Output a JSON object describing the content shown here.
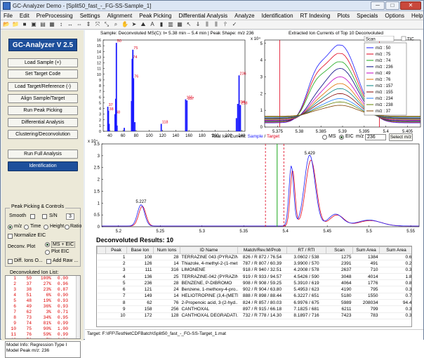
{
  "window": {
    "title": "GC-Analyzer Demo - [Split50_fast_-_FG-SS-Sample_1]",
    "min": "─",
    "max": "□",
    "close": "✕"
  },
  "menu": [
    "File",
    "Edit",
    "PreProcessing",
    "Settings",
    "Alignment",
    "Peak Picking",
    "Differential Analysis",
    "Analyze",
    "Identification",
    "RT Indexing",
    "Plots",
    "Specials",
    "Options",
    "Help"
  ],
  "sidebar": {
    "logo": "GC-Analyzer V 2.5",
    "buttons": [
      "Load Sample (+)",
      "Set Target Code",
      "Load Target/Reference (-)",
      "Align Sample/Target",
      "Run Peak Picking",
      "Differential Analysis",
      "Clustering/Deconvolution"
    ],
    "run_full": "Run Full Analysis",
    "identification": "Identification",
    "group_title": "Peak Picking & Controls",
    "smooth": "Smooth",
    "sn": "S/N",
    "sn_value": "3",
    "mz": "m/z",
    "time": "Time",
    "height": "Height",
    "ratio": "Ratio",
    "normalize": "Normalize EIC",
    "deconv_plot": "Deconv. Plot",
    "ms_eic": "MS + EIC",
    "plot_eic": "Plot EIC",
    "diff_ions": "Diff. Ions O...",
    "add_raw": "Add Raw ...",
    "ion_list_title": "Deconvoluted Ion List:",
    "ions": [
      {
        "mz": "1",
        "ion": "50",
        "pct": "100%",
        "val": "0.00"
      },
      {
        "mz": "2",
        "ion": "37",
        "pct": "27%",
        "val": "0.96"
      },
      {
        "mz": "3",
        "ion": "38",
        "pct": "23%",
        "val": "0.87"
      },
      {
        "mz": "4",
        "ion": "51",
        "pct": "6%",
        "val": "0.90"
      },
      {
        "mz": "5",
        "ion": "48",
        "pct": "19%",
        "val": "0.93"
      },
      {
        "mz": "6",
        "ion": "49",
        "pct": "36%",
        "val": "0.93"
      },
      {
        "mz": "7",
        "ion": "62",
        "pct": "3%",
        "val": "0.71"
      },
      {
        "mz": "8",
        "ion": "73",
        "pct": "34%",
        "val": "0.95"
      },
      {
        "mz": "9",
        "ion": "74",
        "pct": "81%",
        "val": "0.99"
      },
      {
        "mz": "10",
        "ion": "75",
        "pct": "90%",
        "val": "1.00"
      },
      {
        "mz": "11",
        "ion": "76",
        "pct": "59%",
        "val": "0.99"
      },
      {
        "mz": "12",
        "ion": "76",
        "pct": "5%",
        "val": "0.91"
      },
      {
        "mz": "13",
        "ion": "78",
        "pct": "10%",
        "val": "0.99"
      }
    ],
    "model_info": [
      "Model Info: Regression Type I",
      "Model Peak m/z: 236"
    ]
  },
  "ms_plot": {
    "title": "Sample: Deconvoluted MS(C): t= 5.38 min -- 5.4 min | Peak Shape: m/z  236",
    "xlim": [
      30,
      245
    ],
    "ylim": [
      0,
      16
    ],
    "xticks": [
      40,
      60,
      80,
      100,
      120,
      140,
      160,
      180,
      200,
      220,
      240
    ],
    "yticks": [
      0,
      1,
      2,
      3,
      4,
      5,
      6,
      7,
      8,
      9,
      10,
      11,
      12,
      13,
      14,
      15,
      16
    ],
    "peaks": [
      {
        "mz": 37,
        "h": 4.3,
        "label": "37"
      },
      {
        "mz": 38,
        "h": 3.6,
        "label": "38"
      },
      {
        "mz": 39,
        "h": 1.3,
        "label": ""
      },
      {
        "mz": 48,
        "h": 3.0,
        "label": "48"
      },
      {
        "mz": 49,
        "h": 5.7,
        "label": ""
      },
      {
        "mz": 50,
        "h": 15.5,
        "label": "50"
      },
      {
        "mz": 51,
        "h": 1.0,
        "label": ""
      },
      {
        "mz": 62,
        "h": 0.6,
        "label": ""
      },
      {
        "mz": 73,
        "h": 5.3,
        "label": ""
      },
      {
        "mz": 74,
        "h": 12.7,
        "label": "74"
      },
      {
        "mz": 75,
        "h": 14.3,
        "label": "75"
      },
      {
        "mz": 76,
        "h": 9.3,
        "label": "76"
      },
      {
        "mz": 78,
        "h": 1.6,
        "label": ""
      },
      {
        "mz": 118,
        "h": 1.3,
        "label": "118"
      },
      {
        "mz": 155,
        "h": 5.6,
        "label": "155"
      },
      {
        "mz": 157,
        "h": 5.4,
        "label": "157"
      },
      {
        "mz": 232,
        "h": 2.3,
        "label": ""
      },
      {
        "mz": 234,
        "h": 4.8,
        "label": "234"
      },
      {
        "mz": 236,
        "h": 9.8,
        "label": "236"
      },
      {
        "mz": 238,
        "h": 4.6,
        "label": "238"
      }
    ]
  },
  "eic_plot": {
    "title": "Extracted Ion Currents of Top 10 Deconvoluted",
    "exp": "x 10⁴",
    "xticks": [
      "5.375",
      "5.38",
      "5.385",
      "5.39",
      "5.395",
      "5.4",
      "5.405"
    ],
    "xlim": [
      5.372,
      5.408
    ],
    "yticks": [
      "0",
      "1",
      "2",
      "3",
      "4",
      "5"
    ],
    "ylim": [
      0,
      5.2
    ],
    "scan_label": "Scan",
    "tic_label": "TIC",
    "legend": [
      {
        "label": "m/z : 50",
        "color": "#1a1aff"
      },
      {
        "label": "m/z : 75",
        "color": "#e0001a"
      },
      {
        "label": "m/z : 74",
        "color": "#19a819"
      },
      {
        "label": "m/z : 236",
        "color": "#000080"
      },
      {
        "label": "m/z : 49",
        "color": "#c000c0"
      },
      {
        "label": "m/z : 76",
        "color": "#e07000"
      },
      {
        "label": "m/z : 157",
        "color": "#008080"
      },
      {
        "label": "m/z : 155",
        "color": "#800000"
      },
      {
        "label": "m/z : 234",
        "color": "#2080ff"
      },
      {
        "label": "m/z : 238",
        "color": "#608000"
      },
      {
        "label": "m/z : 37",
        "color": "#804000"
      }
    ],
    "series_peaks": [
      4.9,
      4.4,
      3.9,
      3.5,
      3.0,
      2.6,
      2.3,
      2.0,
      1.7,
      1.5,
      1.3
    ]
  },
  "tic_plot": {
    "title_prefix": "Total Ion Current: ",
    "sample_label": "Sample",
    "target_label": "Target",
    "exp": "x 10⁴",
    "xlim": [
      5.18,
      5.56
    ],
    "xticks": [
      "5.2",
      "5.25",
      "5.3",
      "5.35",
      "5.4",
      "5.45",
      "5.5",
      "5.55"
    ],
    "ylim": [
      0,
      3.5
    ],
    "yticks": [
      "0",
      "0.5",
      "1",
      "1.5",
      "2",
      "2.5",
      "3",
      "3.5"
    ],
    "labels": [
      {
        "x": 5.227,
        "y": 0.95,
        "text": "5.227"
      },
      {
        "x": 5.429,
        "y": 3.0,
        "text": "5.429"
      }
    ],
    "ms_label": "MS",
    "eic_label": "EIC",
    "mz_label": "m/z",
    "mz_value": "236",
    "select_mz": "Select m/z"
  },
  "results": {
    "title": "Deconvoluted Results: 10",
    "columns": [
      "",
      "Peak",
      "Base Ion",
      "Num Ions",
      "ID Name",
      "Match/Rev.M/Prob",
      "RT / RTI",
      "Scan",
      "Sum Area",
      "Sum Area"
    ],
    "rows": [
      [
        "1",
        "108",
        "28",
        "TERRAZINE 043 (PYRAZIN...",
        "826 / R 872 / 76.54",
        "3.0602 / 538",
        "1275",
        "1384",
        "0.6"
      ],
      [
        "2",
        "126",
        "14",
        "Thiazole, 4-methyl-2-(1-met...",
        "787 / R 807 / 60.39",
        "3.9900 / 570",
        "2391",
        "491",
        "0.2"
      ],
      [
        "3",
        "111",
        "316",
        "LIMONENE",
        "918 / R 940 / 32.51",
        "4.2008 / 578",
        "2637",
        "710",
        "0.3"
      ],
      [
        "4",
        "136",
        "25",
        "TERRAZINE-042 (PYRAZIN...",
        "919 / R 933 / 94.57",
        "4.5426 / 590",
        "3048",
        "4014",
        "1.8"
      ],
      [
        "5",
        "236",
        "28",
        "BENZENE, P-DIBROMO",
        "908 / R 908 / 59.25",
        "5.3910 / 619",
        "4064",
        "1776",
        "0.8"
      ],
      [
        "6",
        "121",
        "24",
        "Benzene, 1-methoxy-4-pro...",
        "902 / R 904 / 63.80",
        "5.4953 / 623",
        "4190",
        "795",
        "0.3"
      ],
      [
        "7",
        "149",
        "14",
        "HELIOTROPINE (3,4-(METH...",
        "888 / R 898 / 88.44",
        "6.3227 / 651",
        "5180",
        "1550",
        "0.7"
      ],
      [
        "8",
        "62",
        "76",
        "2-Propenoic acid, 3-(2-hyd...",
        "824 / R 857 / 80.03",
        "6.9976 / 675",
        "5989",
        "208034",
        "94.4"
      ],
      [
        "9",
        "158",
        "256",
        "CANTHOXAL",
        "897 / R 915 / 66.18",
        "7.1825 / 681",
        "6211",
        "799",
        "0.3"
      ],
      [
        "10",
        "172",
        "128",
        "CANTHOXAL DEGRADATI...",
        "732 / R 778 / 14.30",
        "8.1897 / 716",
        "7423",
        "783",
        "0.3"
      ]
    ]
  },
  "target_path": "Target: F:\\IFF\\TestNetCDFBatch\\Split50_fast_-_FG-SS-Target_1.mat",
  "colors": {
    "sample": "#1a1aff",
    "target": "#e0001a",
    "accent": "#1d4f9b"
  }
}
